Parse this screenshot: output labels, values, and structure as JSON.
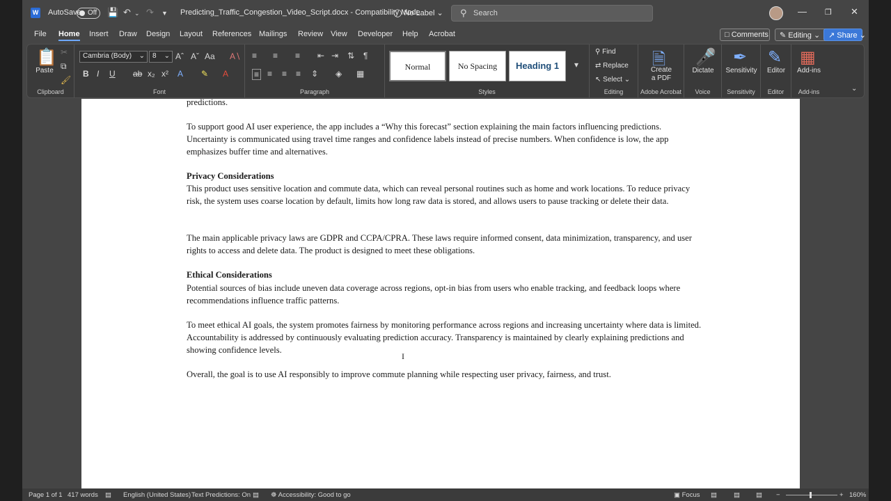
{
  "titlebar": {
    "autosave_label": "AutoSave",
    "autosave_state": "Off",
    "document_title": "Predicting_Traffic_Congestion_Video_Script.docx  -  Compatibility Mode",
    "sensitivity_label": "No Label",
    "search_placeholder": "Search"
  },
  "menu": {
    "tabs": [
      "File",
      "Home",
      "Insert",
      "Draw",
      "Design",
      "Layout",
      "References",
      "Mailings",
      "Review",
      "View",
      "Developer",
      "Help",
      "Acrobat"
    ],
    "active_tab": "Home",
    "comments_label": "Comments",
    "editing_label": "Editing",
    "share_label": "Share"
  },
  "ribbon": {
    "clipboard": {
      "paste": "Paste",
      "label": "Clipboard"
    },
    "font": {
      "name": "Cambria (Body)",
      "size": "8",
      "label": "Font"
    },
    "paragraph": {
      "label": "Paragraph"
    },
    "styles": {
      "normal": "Normal",
      "no_spacing": "No Spacing",
      "heading1": "Heading 1",
      "label": "Styles"
    },
    "editing": {
      "find": "Find",
      "replace": "Replace",
      "select": "Select",
      "label": "Editing"
    },
    "acrobat": {
      "create_pdf_line1": "Create",
      "create_pdf_line2": "a PDF",
      "label": "Adobe Acrobat"
    },
    "voice": {
      "dictate": "Dictate",
      "label": "Voice"
    },
    "sensitivity": {
      "button": "Sensitivity",
      "label": "Sensitivity"
    },
    "editor": {
      "button": "Editor",
      "label": "Editor"
    },
    "addins": {
      "button": "Add-ins",
      "label": "Add-ins"
    }
  },
  "document": {
    "p0": "predictions.",
    "p1": "To support good AI user experience, the app includes a “Why this forecast” section explaining the main factors influencing predictions. Uncertainty is communicated using travel time ranges and confidence labels instead of precise numbers. When confidence is low, the app emphasizes buffer time and alternatives.",
    "h_privacy": "Privacy Considerations",
    "p2": "This product uses sensitive location and commute data, which can reveal personal routines such as home and work locations. To reduce privacy risk, the system uses coarse location by default, limits how long raw data is stored, and allows users to pause tracking or delete their data.",
    "p3": "The main applicable privacy laws are GDPR and CCPA/CPRA. These laws require informed consent, data minimization, transparency, and user rights to access and delete data. The product is designed to meet these obligations.",
    "h_ethical": "Ethical Considerations",
    "p4": "Potential sources of bias include uneven data coverage across regions, opt-in bias from users who enable tracking, and feedback loops where recommendations influence traffic patterns.",
    "p5": "To meet ethical AI goals, the system promotes fairness by monitoring performance across regions and increasing uncertainty where data is limited. Accountability is addressed by continuously evaluating prediction accuracy. Transparency is maintained by clearly explaining predictions and showing confidence levels.",
    "p6": "Overall, the goal is to use AI responsibly to improve commute planning while respecting user privacy, fairness, and trust."
  },
  "statusbar": {
    "page": "Page 1 of 1",
    "words": "417 words",
    "language": "English (United States)",
    "text_predictions": "Text Predictions: On",
    "accessibility": "Accessibility: Good to go",
    "focus": "Focus",
    "zoom": "160%"
  }
}
